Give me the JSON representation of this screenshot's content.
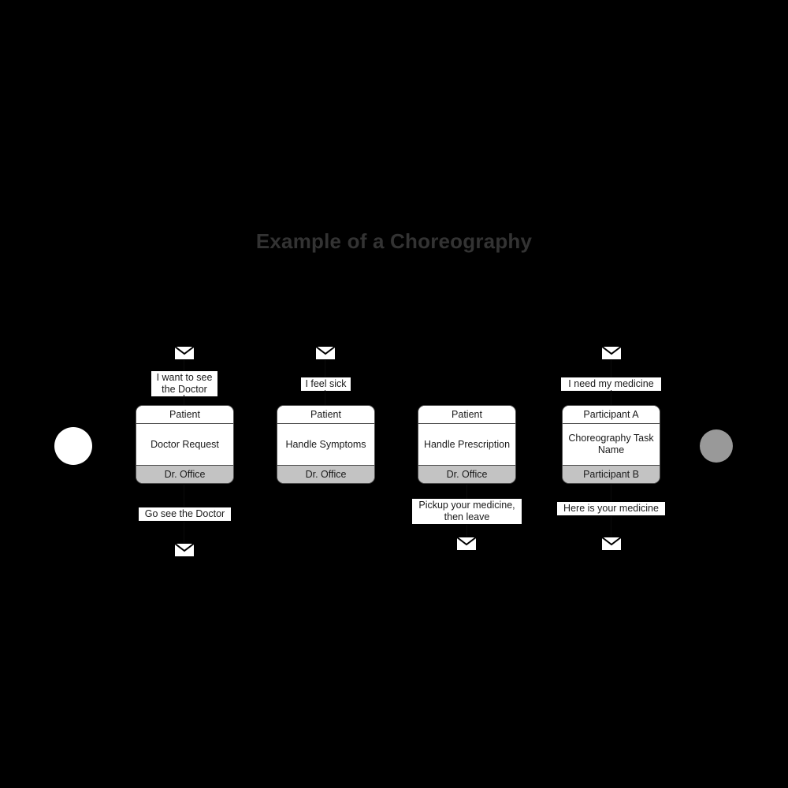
{
  "title": "Example of a Choreography",
  "colors": {
    "background": "#000000",
    "title_text": "#333333",
    "task_fill": "#ffffff",
    "task_border": "#4d4d4d",
    "participant_band_fill": "#c3c3c3",
    "start_event_fill": "#ffffff",
    "end_event_fill": "#999999",
    "label_fill": "#ffffff",
    "text": "#1a1a1a"
  },
  "events": {
    "start": {
      "name": "start-event",
      "fill": "#ffffff"
    },
    "end": {
      "name": "end-event",
      "fill": "#999999"
    }
  },
  "tasks": [
    {
      "id": "task-doctor-request",
      "initiator": "Patient",
      "name": "Doctor Request",
      "responder": "Dr. Office",
      "top_message": "I want to see\nthe Doctor",
      "bottom_message": "Go see the Doctor",
      "top_envelope": "message-envelope-icon",
      "bottom_envelope": "message-envelope-icon"
    },
    {
      "id": "task-handle-symptoms",
      "initiator": "Patient",
      "name": "Handle\nSymptoms",
      "responder": "Dr. Office",
      "top_message": "I feel sick",
      "bottom_message": null,
      "top_envelope": "message-envelope-icon",
      "bottom_envelope": null
    },
    {
      "id": "task-handle-prescription",
      "initiator": "Patient",
      "name": "Handle\nPrescription",
      "responder": "Dr. Office",
      "top_message": null,
      "bottom_message": "Pickup your medicine,\nthen leave",
      "top_envelope": null,
      "bottom_envelope": "message-envelope-icon"
    },
    {
      "id": "task-choreography-template",
      "initiator": "Participant A",
      "name": "Choreography\nTask Name",
      "responder": "Participant B",
      "top_message": "I need my medicine",
      "bottom_message": "Here is your medicine",
      "top_envelope": "message-envelope-icon",
      "bottom_envelope": "message-envelope-icon"
    }
  ]
}
